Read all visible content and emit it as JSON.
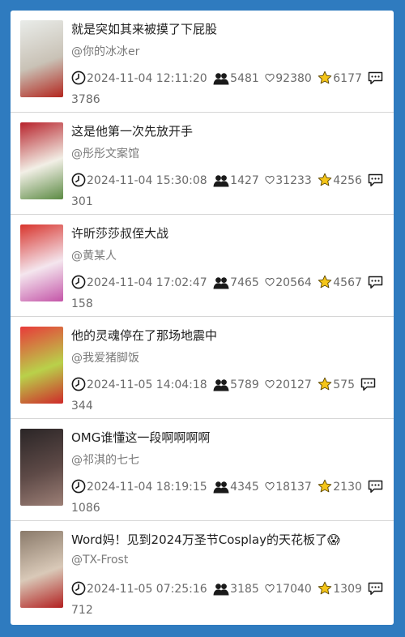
{
  "posts": [
    {
      "title": "就是突如其来被摸了下屁股",
      "author": "@你的冰冰er",
      "time": "2024-11-04 12:11:20",
      "views": "5481",
      "likes": "92380",
      "favorites": "6177",
      "comments": "3786",
      "thumb_colors": [
        "#e9ece9",
        "#c9c2b6",
        "#b3261e"
      ]
    },
    {
      "title": "这是他第一次先放开手",
      "author": "@彤彤文案馆",
      "time": "2024-11-04 15:30:08",
      "views": "1427",
      "likes": "31233",
      "favorites": "4256",
      "comments": "301",
      "thumb_colors": [
        "#b7222b",
        "#f2efe6",
        "#5b8a43"
      ]
    },
    {
      "title": "许昕莎莎叔侄大战",
      "author": "@黄某人",
      "time": "2024-11-04 17:02:47",
      "views": "7465",
      "likes": "20564",
      "favorites": "4567",
      "comments": "158",
      "thumb_colors": [
        "#d8342c",
        "#f4e6ee",
        "#c455a8"
      ]
    },
    {
      "title": "他的灵魂停在了那场地震中",
      "author": "@我爱猪脚饭",
      "time": "2024-11-05 14:04:18",
      "views": "5789",
      "likes": "20127",
      "favorites": "575",
      "comments": "344",
      "thumb_colors": [
        "#e83a3a",
        "#b9d14a",
        "#cf2a2a"
      ]
    },
    {
      "title": "OMG谁懂这一段啊啊啊啊",
      "author": "@祁淇的七七",
      "time": "2024-11-04 18:19:15",
      "views": "4345",
      "likes": "18137",
      "favorites": "2130",
      "comments": "1086",
      "thumb_colors": [
        "#2a2526",
        "#5e4a47",
        "#9c7f76"
      ]
    },
    {
      "title": "Word妈！见到2024万圣节Cosplay的天花板了😱",
      "author": "@TX-Frost",
      "time": "2024-11-05 07:25:16",
      "views": "3185",
      "likes": "17040",
      "favorites": "1309",
      "comments": "712",
      "thumb_colors": [
        "#8a7a6a",
        "#d9c9b8",
        "#b22020"
      ]
    }
  ],
  "icons": {
    "time": "clock-icon",
    "views": "people-icon",
    "likes": "heart-icon",
    "favorites": "star-icon",
    "comments": "comment-icon"
  },
  "colors": {
    "background": "#2f7bbf",
    "card": "#ffffff",
    "title": "#1f1f1f",
    "meta": "#6a6a6a",
    "star": "#f5c518"
  }
}
